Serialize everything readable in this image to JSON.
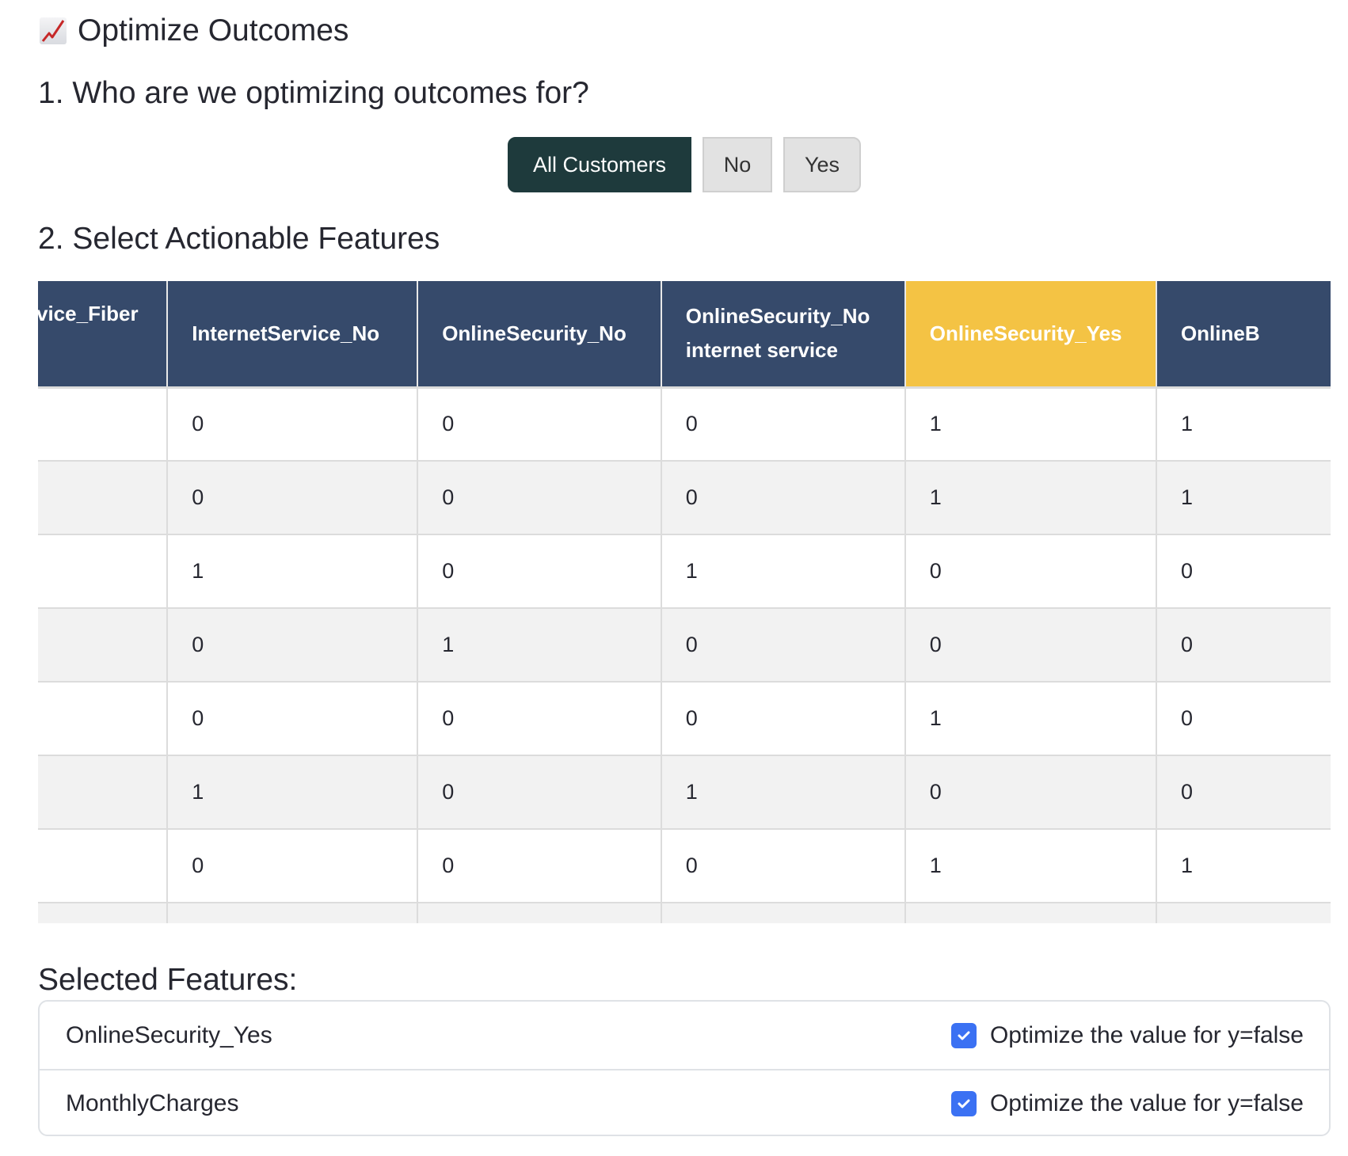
{
  "page": {
    "title": "Optimize Outcomes",
    "title_icon": "chart-increasing-icon"
  },
  "section1": {
    "heading": "1. Who are we optimizing outcomes for?",
    "options": [
      {
        "label": "All Customers",
        "selected": true
      },
      {
        "label": "No",
        "selected": false
      },
      {
        "label": "Yes",
        "selected": false
      }
    ]
  },
  "section2": {
    "heading": "2. Select Actionable Features",
    "table": {
      "columns": [
        {
          "label": "InternetService_Fiber",
          "visible_label": "vice_Fiber",
          "highlighted": false
        },
        {
          "label": "InternetService_No",
          "highlighted": false
        },
        {
          "label": "OnlineSecurity_No",
          "highlighted": false
        },
        {
          "label": "OnlineSecurity_No internet service",
          "highlighted": false
        },
        {
          "label": "OnlineSecurity_Yes",
          "highlighted": true
        },
        {
          "label": "OnlineB",
          "highlighted": false
        }
      ],
      "rows": [
        [
          "",
          "0",
          "0",
          "0",
          "1",
          "1"
        ],
        [
          "",
          "0",
          "0",
          "0",
          "1",
          "1"
        ],
        [
          "",
          "1",
          "0",
          "1",
          "0",
          "0"
        ],
        [
          "",
          "0",
          "1",
          "0",
          "0",
          "0"
        ],
        [
          "",
          "0",
          "0",
          "0",
          "1",
          "0"
        ],
        [
          "",
          "1",
          "0",
          "1",
          "0",
          "0"
        ],
        [
          "",
          "0",
          "0",
          "0",
          "1",
          "1"
        ],
        [
          "",
          "",
          "",
          "",
          "",
          ""
        ]
      ]
    }
  },
  "selected": {
    "heading": "Selected Features:",
    "items": [
      {
        "name": "OnlineSecurity_Yes",
        "option_label": "Optimize the value for y=false",
        "checked": true
      },
      {
        "name": "MonthlyCharges",
        "option_label": "Optimize the value for y=false",
        "checked": true
      }
    ]
  },
  "colors": {
    "header_bg": "#364a6b",
    "highlight_bg": "#f4c344",
    "active_button": "#1e3a3c",
    "checkbox": "#3b71f3"
  }
}
